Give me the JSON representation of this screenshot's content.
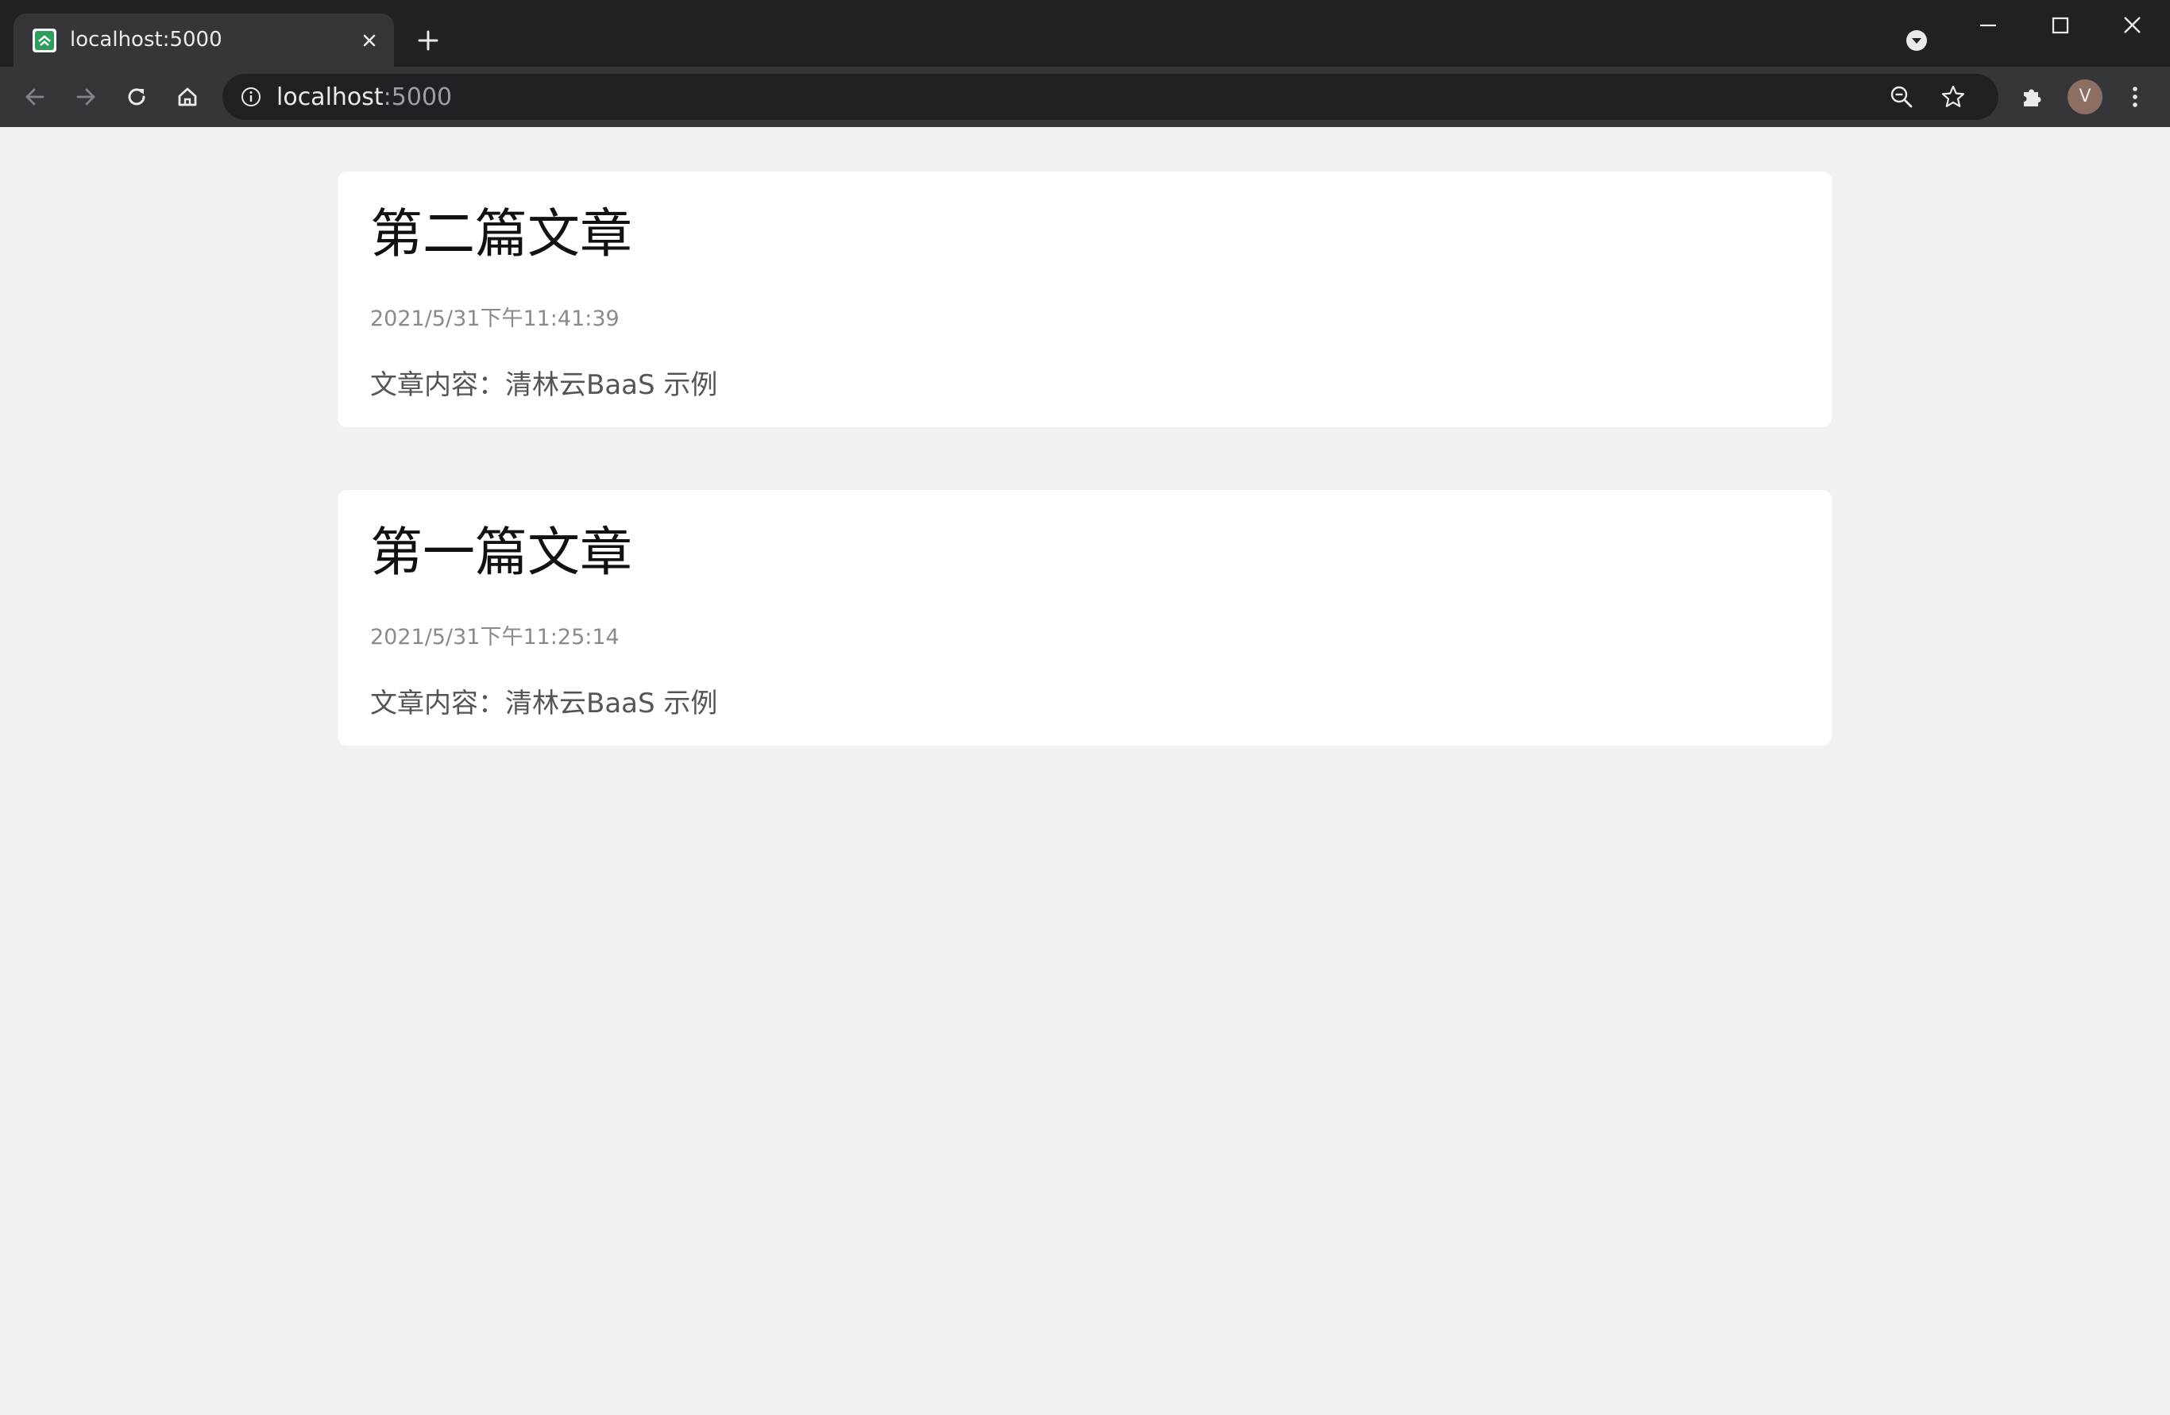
{
  "browser": {
    "tab": {
      "title": "localhost:5000",
      "favicon": "app-favicon"
    },
    "address_bar": {
      "host": "localhost",
      "port": ":5000"
    },
    "profile_initial": "V",
    "icons": {
      "back": "arrow-left-icon",
      "forward": "arrow-right-icon",
      "reload": "reload-icon",
      "home": "home-icon",
      "site_info": "info-icon",
      "zoom": "zoom-out-icon",
      "bookmark": "star-icon",
      "extensions": "puzzle-icon",
      "menu": "kebab-menu-icon"
    },
    "colors": {
      "tabstrip": "#202124",
      "toolbar": "#35363a",
      "omnibox": "#202124"
    }
  },
  "page": {
    "background": "#f1f1f1",
    "articles": [
      {
        "title": "第二篇文章",
        "date": "2021/5/31下午11:41:39",
        "content": "文章内容：清林云BaaS 示例"
      },
      {
        "title": "第一篇文章",
        "date": "2021/5/31下午11:25:14",
        "content": "文章内容：清林云BaaS 示例"
      }
    ]
  }
}
